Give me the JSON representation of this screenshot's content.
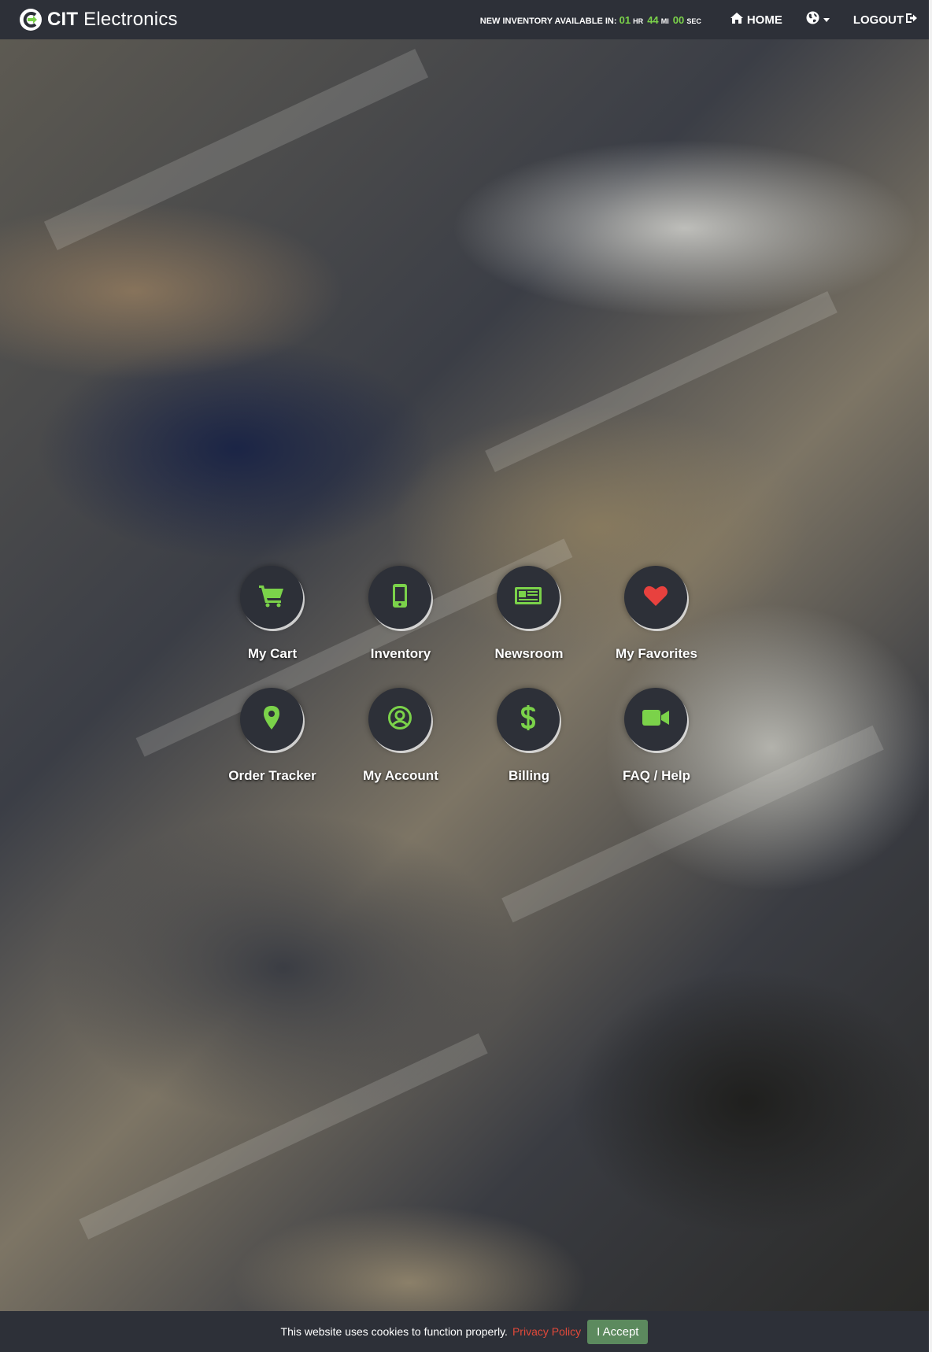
{
  "colors": {
    "navbar_bg": "#2d3038",
    "accent_green": "#7bd24a",
    "policy_link": "#e2493a",
    "accept_button": "#5c8a5e",
    "heart_red": "#e8413e"
  },
  "header": {
    "brand_bold": "CIT",
    "brand_rest": "Electronics",
    "countdown": {
      "label": "NEW INVENTORY AVAILABLE IN:",
      "hours": "01",
      "hours_unit": "HR",
      "minutes": "44",
      "minutes_unit": "MI",
      "seconds": "00",
      "seconds_unit": "SEC"
    },
    "home_label": "HOME",
    "language_icon": "globe-icon",
    "logout_label": "LOGOUT"
  },
  "tiles": [
    {
      "label": "My Cart",
      "icon": "cart-icon"
    },
    {
      "label": "Inventory",
      "icon": "mobile-phone-icon"
    },
    {
      "label": "Newsroom",
      "icon": "newspaper-icon"
    },
    {
      "label": "My Favorites",
      "icon": "heart-icon"
    },
    {
      "label": "Order Tracker",
      "icon": "map-marker-icon"
    },
    {
      "label": "My Account",
      "icon": "user-circle-icon"
    },
    {
      "label": "Billing",
      "icon": "dollar-icon"
    },
    {
      "label": "FAQ / Help",
      "icon": "video-camera-icon"
    }
  ],
  "cookie_bar": {
    "message": "This website uses cookies to function properly.",
    "policy_link": "Privacy Policy",
    "accept_label": "I Accept"
  }
}
